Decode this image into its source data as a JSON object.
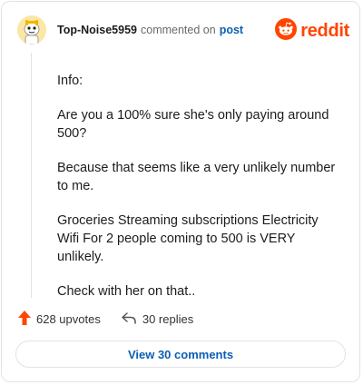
{
  "comment": {
    "author": "Top-Noise5959",
    "verb": "commented on",
    "post_link": "post",
    "brand": "reddit",
    "paragraphs": [
      "Info:",
      "Are you a 100% sure she's only paying around 500?",
      "Because that seems like a very unlikely number to me.",
      "Groceries Streaming subscriptions Electricity Wifi For 2 people coming to 500 is VERY unlikely.",
      "Check with her on that.."
    ]
  },
  "stats": {
    "upvotes": "628 upvotes",
    "replies": "30 replies"
  },
  "footer": {
    "view_comments": "View 30 comments"
  },
  "icons": {
    "upvote": "upvote-arrow-icon",
    "reply": "reply-arrow-icon",
    "avatar": "snoo-avatar",
    "logo": "reddit-logo-icon"
  },
  "colors": {
    "brand": "#ff4500",
    "link": "#0b5fb4",
    "avatar_bg": "#fbe7a6"
  }
}
